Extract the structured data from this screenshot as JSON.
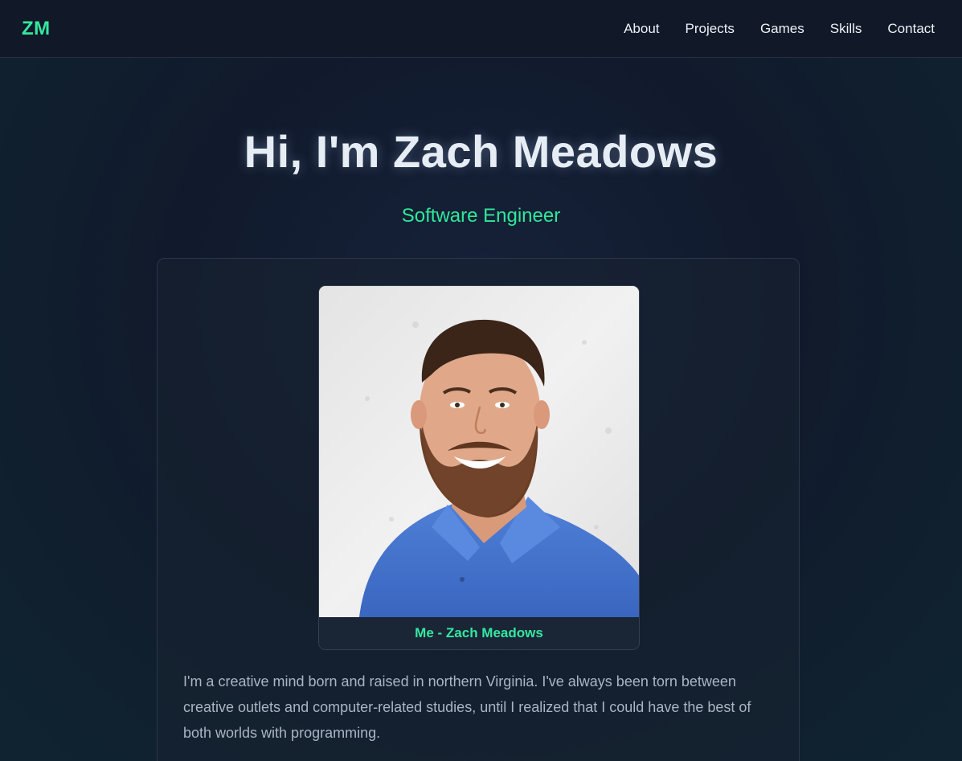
{
  "nav": {
    "logo": "ZM",
    "links": [
      {
        "label": "About"
      },
      {
        "label": "Projects"
      },
      {
        "label": "Games"
      },
      {
        "label": "Skills"
      },
      {
        "label": "Contact"
      }
    ]
  },
  "hero": {
    "title": "Hi, I'm Zach Meadows",
    "subtitle": "Software Engineer"
  },
  "about": {
    "photo_caption": "Me - Zach Meadows",
    "bio": "I'm a creative mind born and raised in northern Virginia. I've always been torn between creative outlets and computer-related studies, until I realized that I could have the best of both worlds with programming."
  },
  "colors": {
    "accent": "#34e8a0",
    "background": "#111a2c",
    "nav_background": "#111827"
  }
}
